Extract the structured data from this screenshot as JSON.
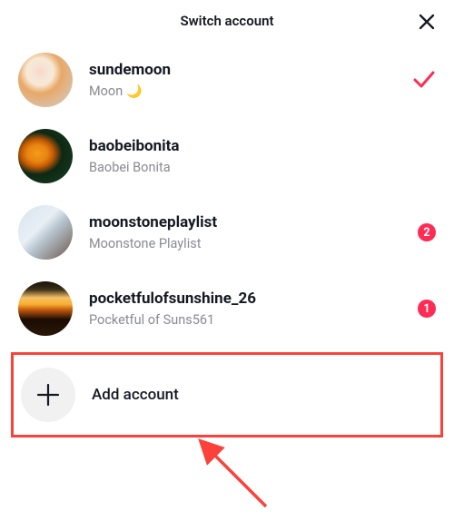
{
  "header": {
    "title": "Switch account"
  },
  "accounts": [
    {
      "username": "sundemoon",
      "displayname": "Moon",
      "emoji": "🌙",
      "selected": true,
      "badge": null
    },
    {
      "username": "baobeibonita",
      "displayname": "Baobei Bonita",
      "emoji": null,
      "selected": false,
      "badge": null
    },
    {
      "username": "moonstoneplaylist",
      "displayname": "Moonstone Playlist",
      "emoji": null,
      "selected": false,
      "badge": "2"
    },
    {
      "username": "pocketfulofsunshine_26",
      "displayname": "Pocketful of Suns561",
      "emoji": null,
      "selected": false,
      "badge": "1"
    }
  ],
  "add_account": {
    "label": "Add account"
  },
  "colors": {
    "accent": "#fe2c55",
    "highlight_box": "#fb423a"
  }
}
